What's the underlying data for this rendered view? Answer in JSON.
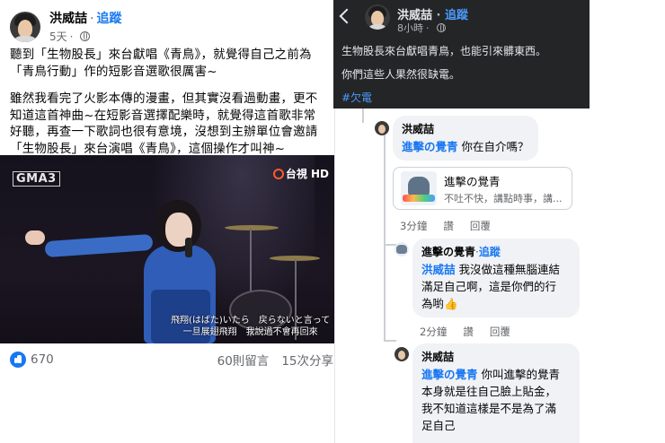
{
  "left_post": {
    "author": "洪威喆",
    "separator": "·",
    "follow_label": "追蹤",
    "time": "5天",
    "paragraph1": "聽到「生物股長」來台獻唱《青鳥》，就覺得自己之前為「青鳥行動」作的短影音選歌很厲害~",
    "paragraph2": "雖然我看完了火影本傳的漫畫，但其實沒看過動畫，更不知道這首神曲~在短影音選擇配樂時，就覺得這首歌非常好聽，再查一下歌詞也很有意境，沒想到主辦單位會邀請「生物股長」來台演唱《青鳥》，這個操作才叫神~",
    "video": {
      "logo_left": "GMA3",
      "logo_right": "台視 HD",
      "subtitle_line1": "飛翔(はばた)いたら　戻らないと言って",
      "subtitle_line2": "一旦展翅飛翔　我說過不會再回來"
    },
    "reactions_count": "670",
    "comments_count": "60則留言",
    "shares_count": "15次分享"
  },
  "right_post": {
    "author": "洪威喆",
    "separator": "·",
    "follow_label": "追蹤",
    "time": "8小時",
    "line1": "生物股長來台獻唱青鳥，也能引來髒東西。",
    "line2": "你們這些人果然很缺電。",
    "hashtag": "#欠電"
  },
  "comments": [
    {
      "author": "洪威喆",
      "mention": "進擊の覺青",
      "text": " 你在自介嗎？",
      "link_card": {
        "title": "進擊の覺青",
        "subtitle": "不吐不快，講點時事，講..."
      },
      "time": "3分鐘",
      "like_label": "讚",
      "reply_label": "回覆"
    },
    {
      "author": "進擊の覺青",
      "separator": "·",
      "follow_label": "追蹤",
      "mention": "洪威喆",
      "text_line1": " 我沒做這種無腦連結",
      "text_line2": "滿足自己啊，這是你們的行",
      "text_line3": "為喲",
      "emoji": "👍",
      "time": "2分鐘",
      "like_label": "讚",
      "reply_label": "回覆"
    },
    {
      "author": "洪威喆",
      "mention": "進擊の覺青",
      "text_line1": " 你叫進擊的覺青",
      "text_line2": "本身就是往自己臉上貼金，",
      "text_line3": "我不知道這樣是不是為了滿",
      "text_line4": "足自己"
    }
  ]
}
